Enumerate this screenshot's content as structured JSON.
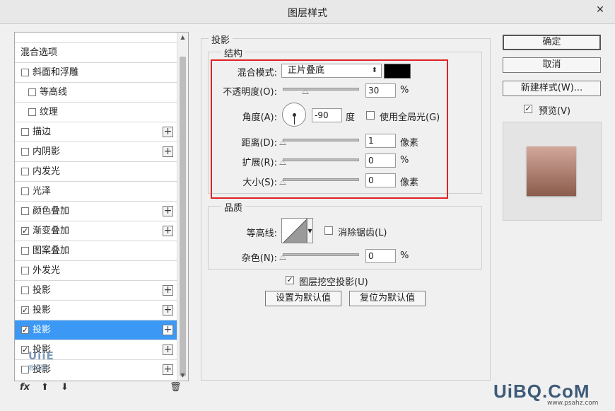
{
  "window": {
    "title": "图层样式",
    "close_glyph": "✕"
  },
  "style_list": {
    "items": [
      {
        "label": "混合选项",
        "checkbox": false,
        "checked": false,
        "indent": 0,
        "plus": false,
        "selected": false
      },
      {
        "label": "斜面和浮雕",
        "checkbox": true,
        "checked": false,
        "indent": 0,
        "plus": false,
        "selected": false
      },
      {
        "label": "等高线",
        "checkbox": true,
        "checked": false,
        "indent": 1,
        "plus": false,
        "selected": false
      },
      {
        "label": "纹理",
        "checkbox": true,
        "checked": false,
        "indent": 1,
        "plus": false,
        "selected": false
      },
      {
        "label": "描边",
        "checkbox": true,
        "checked": false,
        "indent": 0,
        "plus": true,
        "selected": false
      },
      {
        "label": "内阴影",
        "checkbox": true,
        "checked": false,
        "indent": 0,
        "plus": true,
        "selected": false
      },
      {
        "label": "内发光",
        "checkbox": true,
        "checked": false,
        "indent": 0,
        "plus": false,
        "selected": false
      },
      {
        "label": "光泽",
        "checkbox": true,
        "checked": false,
        "indent": 0,
        "plus": false,
        "selected": false
      },
      {
        "label": "颜色叠加",
        "checkbox": true,
        "checked": false,
        "indent": 0,
        "plus": true,
        "selected": false
      },
      {
        "label": "渐变叠加",
        "checkbox": true,
        "checked": true,
        "indent": 0,
        "plus": true,
        "selected": false
      },
      {
        "label": "图案叠加",
        "checkbox": true,
        "checked": false,
        "indent": 0,
        "plus": false,
        "selected": false
      },
      {
        "label": "外发光",
        "checkbox": true,
        "checked": false,
        "indent": 0,
        "plus": false,
        "selected": false
      },
      {
        "label": "投影",
        "checkbox": true,
        "checked": false,
        "indent": 0,
        "plus": true,
        "selected": false
      },
      {
        "label": "投影",
        "checkbox": true,
        "checked": true,
        "indent": 0,
        "plus": true,
        "selected": false
      },
      {
        "label": "投影",
        "checkbox": true,
        "checked": true,
        "indent": 0,
        "plus": true,
        "selected": true
      },
      {
        "label": "投影",
        "checkbox": true,
        "checked": true,
        "indent": 0,
        "plus": true,
        "selected": false
      },
      {
        "label": "投影",
        "checkbox": true,
        "checked": false,
        "indent": 0,
        "plus": true,
        "selected": false
      }
    ],
    "plus_glyph": "+",
    "check_glyph": "✓",
    "scroll_up_glyph": "▲",
    "scroll_down_glyph": "▼"
  },
  "list_watermark": {
    "logo": "UiiE",
    "text": "教程网"
  },
  "bottom_tools": {
    "fx": "fx",
    "up": "⬆",
    "down": "⬇",
    "trash": "🗑"
  },
  "drop_shadow": {
    "legend": "投影",
    "structure": {
      "legend": "结构",
      "blend_mode_label": "混合模式:",
      "blend_mode_value": "正片叠底",
      "blend_mode_arrow": "⬍",
      "shadow_color": "#000000",
      "opacity_label": "不透明度(O):",
      "opacity_value": "30",
      "opacity_fraction": 0.3,
      "opacity_unit": "%",
      "angle_label": "角度(A):",
      "angle_value": "-90",
      "angle_unit": "度",
      "global_light_label": "使用全局光(G)",
      "global_light_checked": false,
      "distance_label": "距离(D):",
      "distance_value": "1",
      "distance_fraction": 0.0,
      "distance_unit": "像素",
      "spread_label": "扩展(R):",
      "spread_value": "0",
      "spread_fraction": 0.0,
      "spread_unit": "%",
      "size_label": "大小(S):",
      "size_value": "0",
      "size_fraction": 0.0,
      "size_unit": "像素"
    },
    "quality": {
      "legend": "品质",
      "contour_label": "等高线:",
      "contour_arrow": "▼",
      "anti_alias_label": "消除锯齿(L)",
      "anti_alias_checked": false,
      "noise_label": "杂色(N):",
      "noise_value": "0",
      "noise_fraction": 0.0,
      "noise_unit": "%"
    },
    "knockout_label": "图层挖空投影(U)",
    "knockout_checked": true,
    "set_default_label": "设置为默认值",
    "reset_default_label": "复位为默认值"
  },
  "buttons": {
    "ok": "确定",
    "cancel": "取消",
    "new_style": "新建样式(W)...",
    "preview_label": "预览(V)",
    "preview_checked": true
  },
  "highlight_color": "#e02222",
  "selection_color": "#3b99f5",
  "site_watermark": {
    "logo": "UiBQ.CoM",
    "url": "www.psahz.com"
  }
}
